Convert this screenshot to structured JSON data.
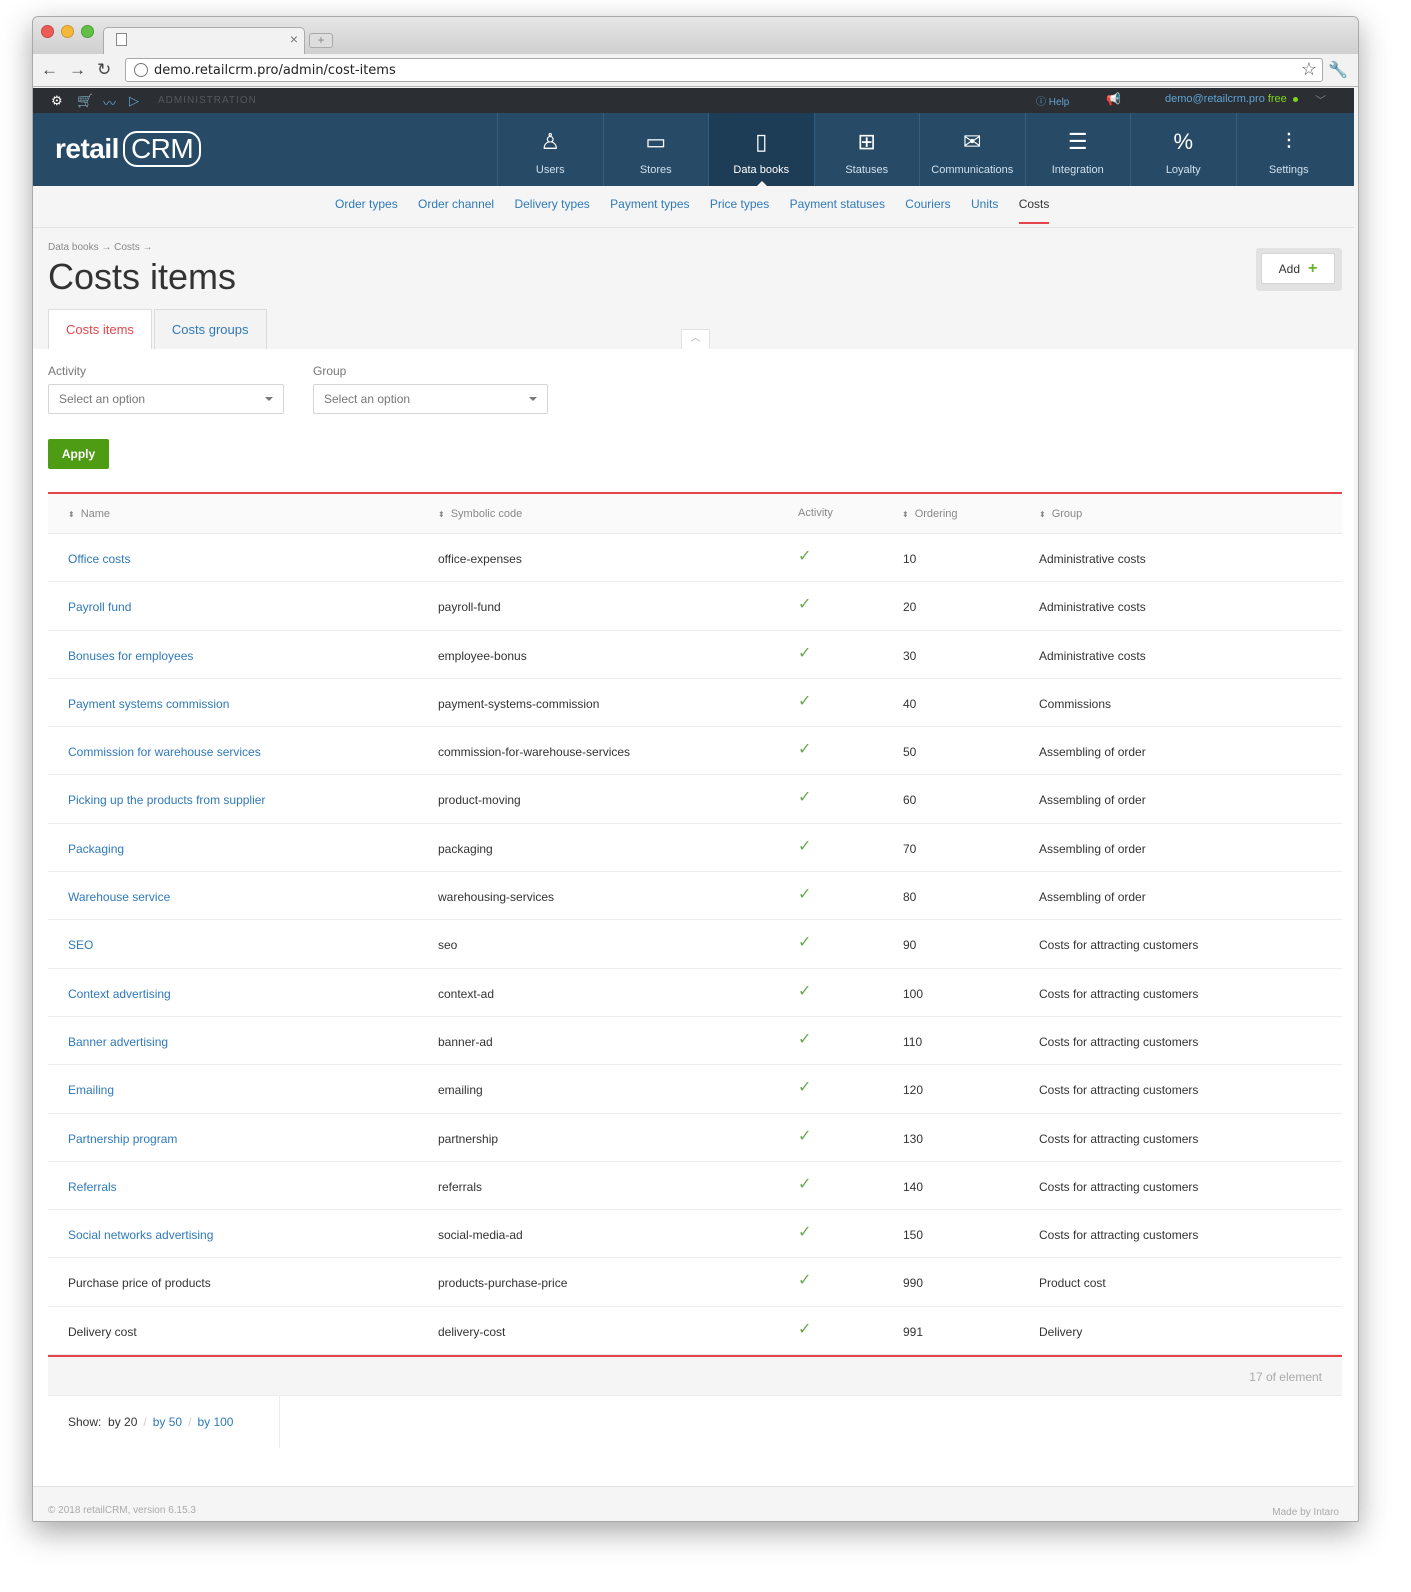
{
  "browser": {
    "url": "demo.retailcrm.pro/admin/cost-items"
  },
  "adminbar": {
    "label": "ADMINISTRATION",
    "help": "Help",
    "user_email": "demo@retailcrm.pro",
    "plan": "free"
  },
  "header": {
    "logo_text": "retail",
    "logo_crm": "CRM",
    "nav": [
      {
        "label": "Users",
        "icon": "user-icon"
      },
      {
        "label": "Stores",
        "icon": "store-icon"
      },
      {
        "label": "Data books",
        "icon": "book-icon",
        "active": true
      },
      {
        "label": "Statuses",
        "icon": "statuses-icon"
      },
      {
        "label": "Communications",
        "icon": "communications-icon"
      },
      {
        "label": "Integration",
        "icon": "integration-icon"
      },
      {
        "label": "Loyalty",
        "icon": "loyalty-icon"
      },
      {
        "label": "Settings",
        "icon": "settings-icon"
      }
    ]
  },
  "subnav": [
    "Order types",
    "Order channel",
    "Delivery types",
    "Payment types",
    "Price types",
    "Payment statuses",
    "Couriers",
    "Units",
    "Costs"
  ],
  "breadcrumb": "Data books → Costs →",
  "page_title": "Costs items",
  "add_label": "Add",
  "tabs": [
    {
      "label": "Costs items",
      "active": true
    },
    {
      "label": "Costs groups",
      "active": false
    }
  ],
  "filters": {
    "activity_label": "Activity",
    "activity_placeholder": "Select an option",
    "group_label": "Group",
    "group_placeholder": "Select an option",
    "apply_label": "Apply"
  },
  "table": {
    "columns": [
      "Name",
      "Symbolic code",
      "Activity",
      "Ordering",
      "Group"
    ],
    "rows": [
      {
        "name": "Office costs",
        "code": "office-expenses",
        "active": true,
        "ordering": "10",
        "group": "Administrative costs",
        "link": true
      },
      {
        "name": "Payroll fund",
        "code": "payroll-fund",
        "active": true,
        "ordering": "20",
        "group": "Administrative costs",
        "link": true
      },
      {
        "name": "Bonuses for employees",
        "code": "employee-bonus",
        "active": true,
        "ordering": "30",
        "group": "Administrative costs",
        "link": true
      },
      {
        "name": "Payment systems commission",
        "code": "payment-systems-commission",
        "active": true,
        "ordering": "40",
        "group": "Commissions",
        "link": true
      },
      {
        "name": "Commission for warehouse services",
        "code": "commission-for-warehouse-services",
        "active": true,
        "ordering": "50",
        "group": "Assembling of order",
        "link": true
      },
      {
        "name": "Picking up the products from supplier",
        "code": "product-moving",
        "active": true,
        "ordering": "60",
        "group": "Assembling of order",
        "link": true
      },
      {
        "name": "Packaging",
        "code": "packaging",
        "active": true,
        "ordering": "70",
        "group": "Assembling of order",
        "link": true
      },
      {
        "name": "Warehouse service",
        "code": "warehousing-services",
        "active": true,
        "ordering": "80",
        "group": "Assembling of order",
        "link": true
      },
      {
        "name": "SEO",
        "code": "seo",
        "active": true,
        "ordering": "90",
        "group": "Costs for attracting customers",
        "link": true
      },
      {
        "name": "Context advertising",
        "code": "context-ad",
        "active": true,
        "ordering": "100",
        "group": "Costs for attracting customers",
        "link": true
      },
      {
        "name": "Banner advertising",
        "code": "banner-ad",
        "active": true,
        "ordering": "110",
        "group": "Costs for attracting customers",
        "link": true
      },
      {
        "name": "Emailing",
        "code": "emailing",
        "active": true,
        "ordering": "120",
        "group": "Costs for attracting customers",
        "link": true
      },
      {
        "name": "Partnership program",
        "code": "partnership",
        "active": true,
        "ordering": "130",
        "group": "Costs for attracting customers",
        "link": true
      },
      {
        "name": "Referrals",
        "code": "referrals",
        "active": true,
        "ordering": "140",
        "group": "Costs for attracting customers",
        "link": true
      },
      {
        "name": "Social networks advertising",
        "code": "social-media-ad",
        "active": true,
        "ordering": "150",
        "group": "Costs for attracting customers",
        "link": true
      },
      {
        "name": "Purchase price of products",
        "code": "products-purchase-price",
        "active": true,
        "ordering": "990",
        "group": "Product cost",
        "link": false
      },
      {
        "name": "Delivery cost",
        "code": "delivery-cost",
        "active": true,
        "ordering": "991",
        "group": "Delivery",
        "link": false
      }
    ],
    "count_text": "17 of element"
  },
  "pager": {
    "show_label": "Show:",
    "options": [
      "by 20",
      "by 50",
      "by 100"
    ],
    "current": "by 20"
  },
  "footer": {
    "copyright": "© 2018 retailCRM, version 6.15.3",
    "made_by": "Made by Intaro"
  },
  "colors": {
    "header_bg": "#274a66",
    "accent_red": "#e5454a",
    "link_blue": "#2f79b9",
    "apply_green": "#4e9b14"
  }
}
